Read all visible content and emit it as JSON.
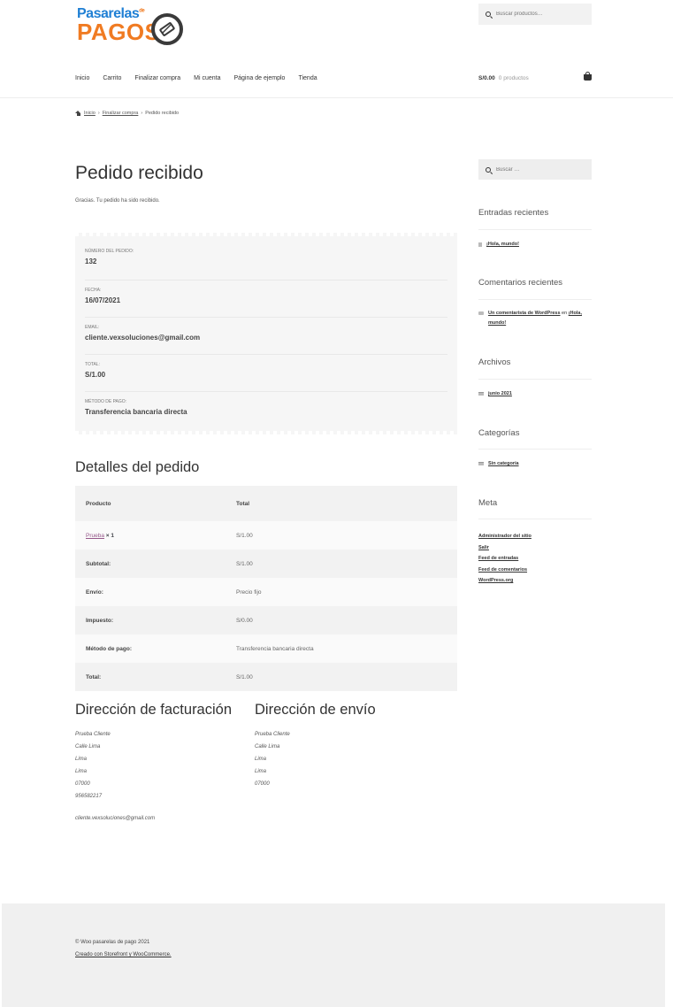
{
  "brand": {
    "line1": "Pasarelas",
    "sup": "de",
    "line2": "PAGOS"
  },
  "header_search": {
    "placeholder": "Buscar productos…"
  },
  "nav": [
    "Inicio",
    "Carrito",
    "Finalizar compra",
    "Mi cuenta",
    "Página de ejemplo",
    "Tienda"
  ],
  "cart": {
    "amount": "S/0.00",
    "count": "0 productos"
  },
  "breadcrumb": {
    "home": "Inicio",
    "sep1": "›",
    "checkout": "Finalizar compra",
    "sep2": "›",
    "current": "Pedido recibido"
  },
  "page": {
    "title": "Pedido recibido",
    "thanks": "Gracias. Tu pedido ha sido recibido."
  },
  "overview": [
    {
      "label": "Número del pedido:",
      "value": "132"
    },
    {
      "label": "Fecha:",
      "value": "16/07/2021"
    },
    {
      "label": "Email:",
      "value": "cliente.vexsoluciones@gmail.com"
    },
    {
      "label": "Total:",
      "value": "S/1.00"
    },
    {
      "label": "Método de pago:",
      "value": "Transferencia bancaria directa"
    }
  ],
  "details": {
    "title": "Detalles del pedido",
    "col_product": "Producto",
    "col_total": "Total",
    "item_name": "Prueba",
    "item_qty": "× 1",
    "item_total": "S/1.00",
    "rows": [
      {
        "label": "Subtotal:",
        "value": "S/1.00"
      },
      {
        "label": "Envío:",
        "value": "Precio fijo"
      },
      {
        "label": "Impuesto:",
        "value": "S/0.00"
      },
      {
        "label": "Método de pago:",
        "value": "Transferencia bancaria directa"
      },
      {
        "label": "Total:",
        "value": "S/1.00"
      }
    ]
  },
  "billing": {
    "title": "Dirección de facturación",
    "lines": [
      "Prueba Cliente",
      "Calle Lima",
      "Lima",
      "Lima",
      "07000",
      "956582217"
    ],
    "email": "cliente.vexsoluciones@gmail.com"
  },
  "shipping": {
    "title": "Dirección de envío",
    "lines": [
      "Prueba Cliente",
      "Calle Lima",
      "Lima",
      "Lima",
      "07000"
    ]
  },
  "sidebar": {
    "search_placeholder": "Buscar …",
    "recent_posts_title": "Entradas recientes",
    "recent_post": "¡Hola, mundo!",
    "recent_comments_title": "Comentarios recientes",
    "comment_author": "Un comentarista de WordPress",
    "comment_on": "en",
    "comment_post": "¡Hola, mundo!",
    "archives_title": "Archivos",
    "archive": "junio 2021",
    "categories_title": "Categorías",
    "category": "Sin categoría",
    "meta_title": "Meta",
    "meta_links": [
      "Administrador del sitio",
      "Salir",
      "Feed de entradas",
      "Feed de comentarios",
      "WordPress.org"
    ]
  },
  "footer": {
    "copyright": "© Woo pasarelas de pago 2021",
    "credit": "Creado con Storefront y WooCommerce."
  },
  "colors": {
    "logo_blue": "#1f7fd4",
    "logo_orange": "#f07b22",
    "link_purple": "#96588a"
  }
}
